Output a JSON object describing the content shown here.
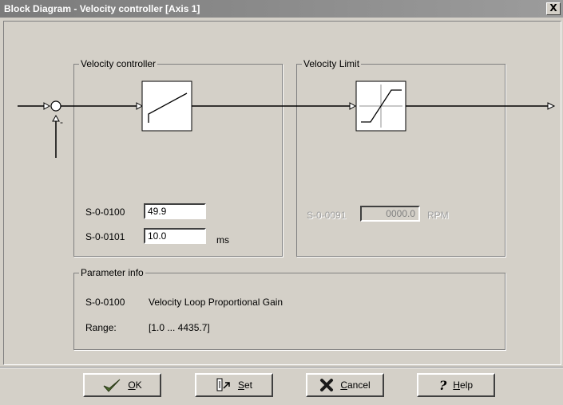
{
  "window": {
    "title": "Block Diagram - Velocity controller [Axis 1]",
    "close_glyph": "X"
  },
  "velocity_controller": {
    "title": "Velocity controller",
    "params": [
      {
        "id": "S-0-0100",
        "value": "49.9",
        "unit": ""
      },
      {
        "id": "S-0-0101",
        "value": "10.0",
        "unit": "ms"
      }
    ]
  },
  "velocity_limit": {
    "title": "Velocity Limit",
    "param": {
      "id": "S-0-0091",
      "value": "0000.0",
      "unit": "RPM"
    }
  },
  "parameter_info": {
    "title": "Parameter info",
    "param_id": "S-0-0100",
    "description": "Velocity Loop Proportional Gain",
    "range_label": "Range:",
    "range_value": "[1.0 ... 4435.7]"
  },
  "diagram": {
    "summing_sign": "-"
  },
  "buttons": {
    "ok": {
      "underline": "O",
      "rest": "K"
    },
    "set": {
      "underline": "S",
      "rest": "et"
    },
    "cancel": {
      "underline": "C",
      "rest": "ancel"
    },
    "help": {
      "underline": "H",
      "rest": "elp"
    }
  },
  "icons": {
    "ok": "checkmark-icon",
    "set": "set-parameter-icon",
    "cancel": "x-mark-icon",
    "help": "question-mark-icon"
  },
  "colors": {
    "title_bar": "#8a8a8a",
    "dialog_face": "#d4d0c8",
    "ok_check": "#4a6a2a",
    "cancel_x": "#1a1a1a"
  }
}
